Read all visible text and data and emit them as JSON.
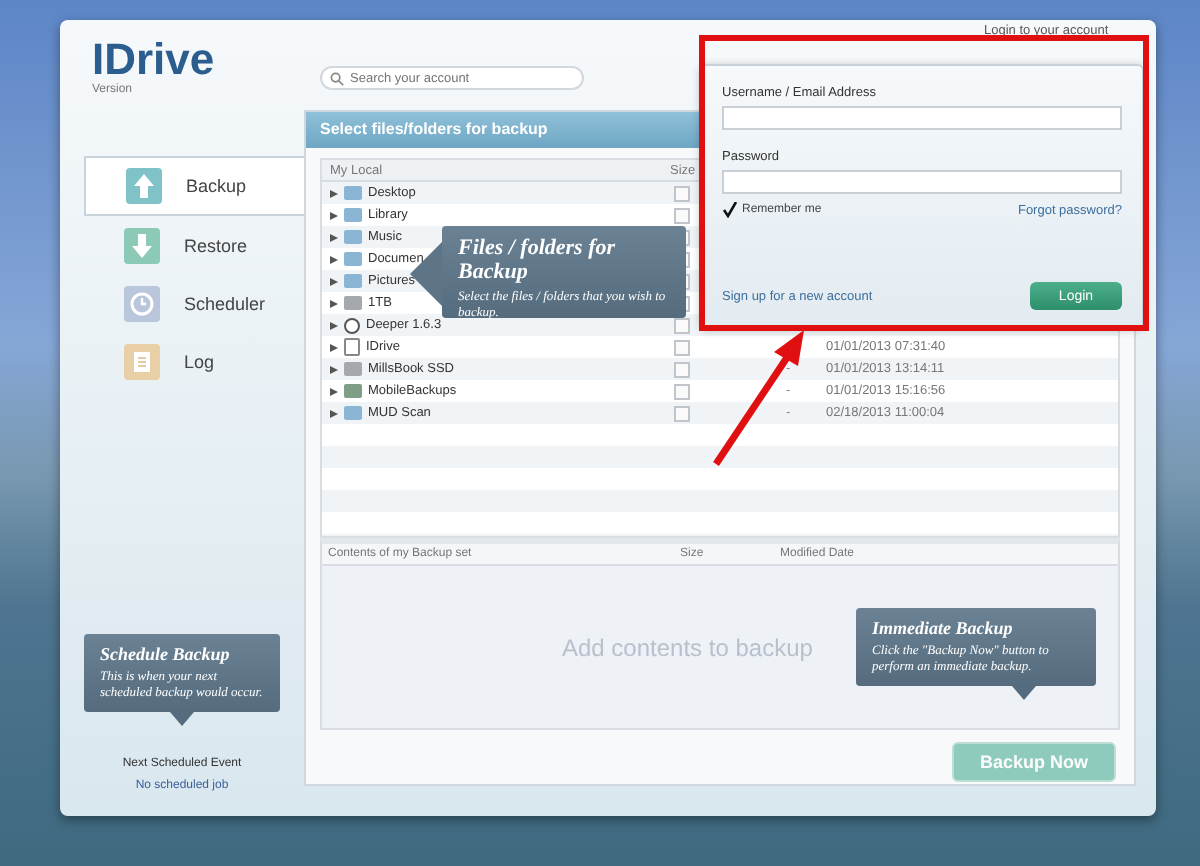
{
  "window": {
    "logo": "IDrive",
    "version": "Version",
    "search": {
      "placeholder": "Search your account"
    },
    "account_menu": "Login to your account"
  },
  "sidebar": {
    "items": [
      {
        "label": "Backup",
        "kind": "backup",
        "selected": true
      },
      {
        "label": "Restore",
        "kind": "restore",
        "selected": false
      },
      {
        "label": "Scheduler",
        "kind": "scheduler",
        "selected": false
      },
      {
        "label": "Log",
        "kind": "log",
        "selected": false
      }
    ],
    "tooltip": {
      "title": "Schedule Backup",
      "text": "This is when your next scheduled backup would occur."
    },
    "next_event_label": "Next Scheduled Event",
    "next_event_value": "No scheduled job"
  },
  "main": {
    "header": "Select files/folders for backup",
    "file_list": {
      "columns": [
        "My Local",
        "Size"
      ],
      "rows": [
        {
          "name": "Desktop",
          "kind": "folder",
          "checked": false
        },
        {
          "name": "Library",
          "kind": "folder",
          "checked": false
        },
        {
          "name": "Music",
          "kind": "folder",
          "checked": false
        },
        {
          "name": "Documen",
          "kind": "folder",
          "checked": false
        },
        {
          "name": "Pictures",
          "kind": "folder",
          "checked": false
        },
        {
          "name": "1TB",
          "kind": "drive",
          "checked": false
        },
        {
          "name": "Deeper 1.6.3",
          "kind": "disk",
          "checked": false
        },
        {
          "name": "IDrive",
          "kind": "file",
          "checked": false,
          "modified": "01/01/2013 07:31:40"
        },
        {
          "name": "MillsBook SSD",
          "kind": "drive",
          "checked": false,
          "size": "-",
          "modified": "01/01/2013 13:14:11"
        },
        {
          "name": "MobileBackups",
          "kind": "backup",
          "checked": false,
          "size": "-",
          "modified": "01/01/2013 15:16:56"
        },
        {
          "name": "MUD Scan",
          "kind": "folder",
          "checked": false,
          "size": "-",
          "modified": "02/18/2013 11:00:04"
        }
      ]
    },
    "tooltip": {
      "title": "Files / folders for Backup",
      "text": "Select the files / folders that you wish to backup."
    },
    "backup_set": {
      "columns": [
        "Contents of my Backup set",
        "Size",
        "Modified Date"
      ],
      "placeholder": "Add contents to backup"
    },
    "backup_tooltip": {
      "title": "Immediate Backup",
      "text": "Click the \"Backup Now\" button to perform an immediate backup."
    },
    "backup_button": {
      "label": "Backup Now",
      "disabled": true
    }
  },
  "login": {
    "username_label": "Username / Email Address",
    "password_label": "Password",
    "remember": {
      "label": "Remember me",
      "checked": true
    },
    "forgot": "Forgot password?",
    "signup": "Sign up for a new account",
    "button": "Login"
  }
}
